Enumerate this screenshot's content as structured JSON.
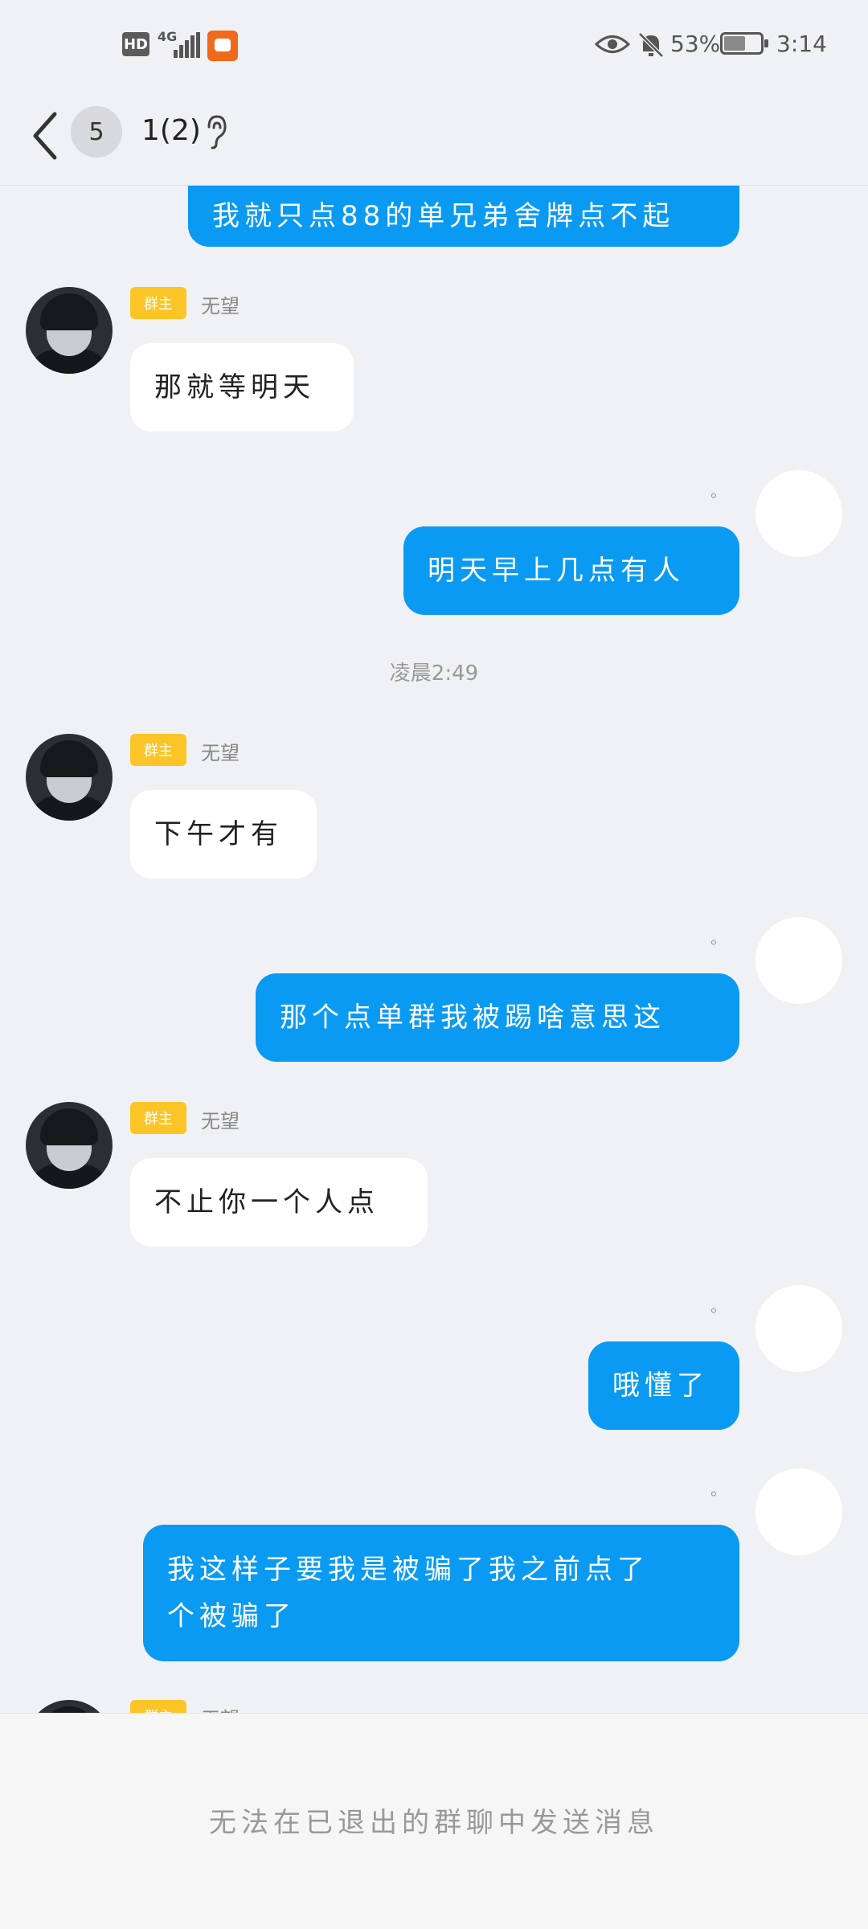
{
  "status_bar": {
    "hd": "HD",
    "network": "4G",
    "battery_pct": "53%",
    "time": "3:14",
    "icons": [
      "signal-icon",
      "app-notification-icon",
      "eye-icon",
      "bell-muted-icon",
      "battery-icon"
    ]
  },
  "header": {
    "unread_count": "5",
    "title": "1(2)"
  },
  "messages": {
    "m0": "我就只点88的单兄弟舍牌点不起",
    "m1_role": "群主",
    "m1_name": "无望",
    "m1": "那就等明天",
    "m2": "明天早上几点有人",
    "time1": "凌晨2:49",
    "m3_role": "群主",
    "m3_name": "无望",
    "m3": "下午才有",
    "m4": "那个点单群我被踢啥意思这",
    "m5_role": "群主",
    "m5_name": "无望",
    "m5": "不止你一个人点",
    "m6": "哦懂了",
    "m7_line1": "我这样子要我是被骗了我之前点了",
    "m7_line2": "个被骗了",
    "m8_role": "群主",
    "m8_name": "无望",
    "read_dot": "。"
  },
  "footer": {
    "notice": "无法在已退出的群聊中发送消息"
  }
}
